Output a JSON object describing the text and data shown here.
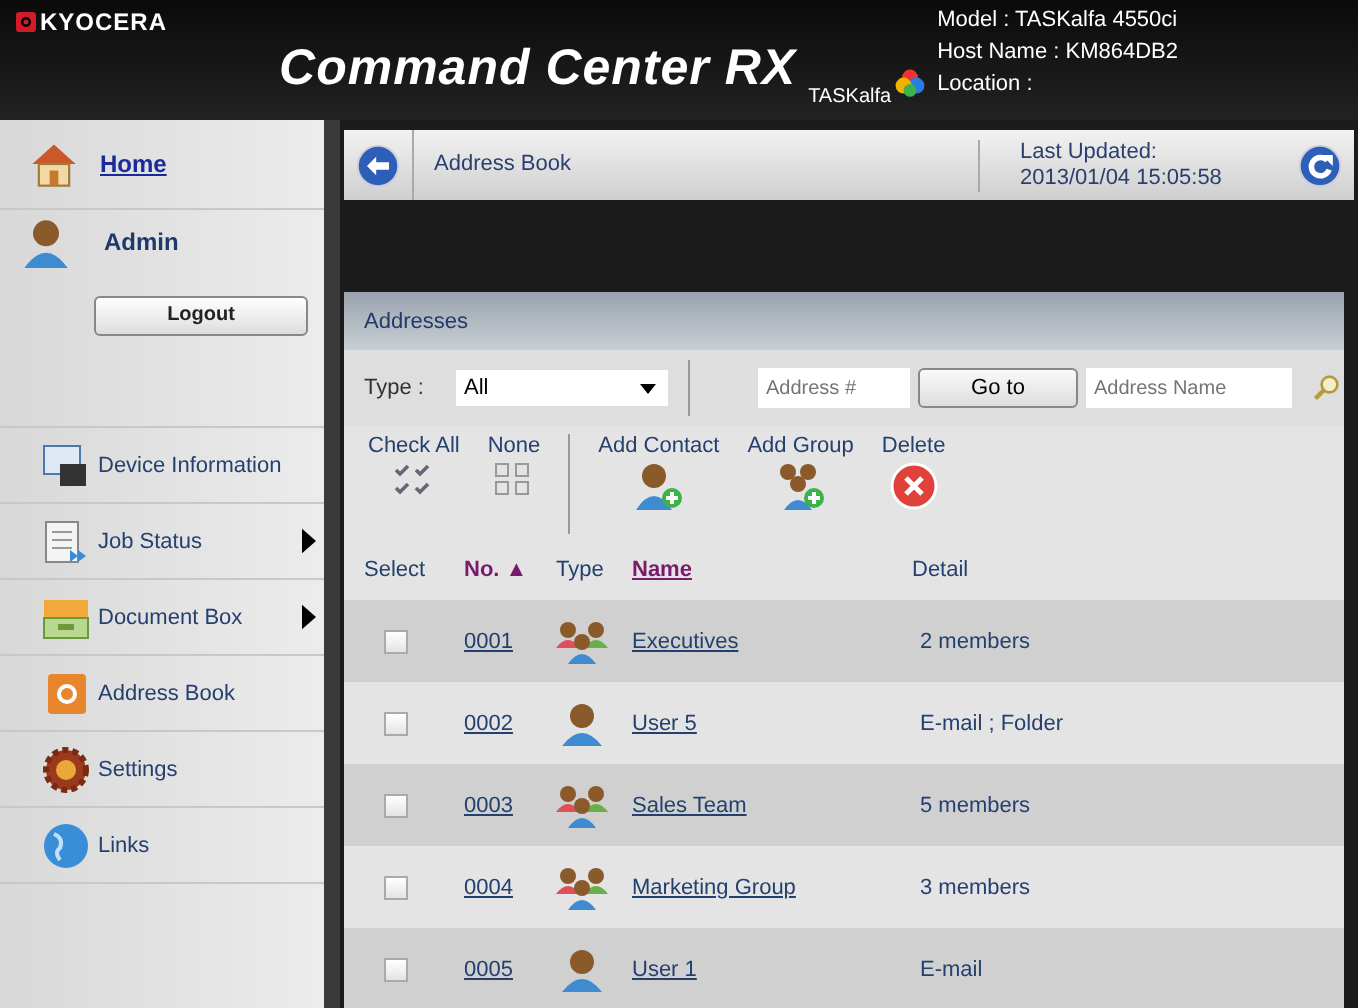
{
  "header": {
    "brand": "KYOCERA",
    "title": "Command Center RX",
    "product": "TASKalfa",
    "info": [
      "Model : TASKalfa 4550ci",
      "Host Name : KM864DB2",
      "Location :"
    ]
  },
  "sidebar": {
    "home": {
      "label": "Home"
    },
    "user": {
      "name": "Admin"
    },
    "logout": "Logout",
    "items": [
      {
        "label": "Device Information",
        "kind": "device",
        "has_submenu": false
      },
      {
        "label": "Job Status",
        "kind": "jobs",
        "has_submenu": true
      },
      {
        "label": "Document Box",
        "kind": "box",
        "has_submenu": true
      },
      {
        "label": "Address Book",
        "kind": "book",
        "has_submenu": false
      },
      {
        "label": "Settings",
        "kind": "gear",
        "has_submenu": false
      },
      {
        "label": "Links",
        "kind": "globe",
        "has_submenu": false
      }
    ]
  },
  "topbar": {
    "title": "Address Book",
    "updated_label": "Last Updated:",
    "updated_value": "2013/01/04 15:05:58"
  },
  "panel": {
    "title": "Addresses",
    "filter": {
      "type_label": "Type :",
      "type_value": "All",
      "number_placeholder": "Address #",
      "goto": "Go to",
      "name_placeholder": "Address Name"
    },
    "actions": [
      {
        "label": "Check All",
        "kind": "checkall"
      },
      {
        "label": "None",
        "kind": "none"
      },
      {
        "label": "Add Contact",
        "kind": "addcontact"
      },
      {
        "label": "Add Group",
        "kind": "addgroup"
      },
      {
        "label": "Delete",
        "kind": "delete"
      }
    ],
    "columns": [
      {
        "label": "Select",
        "kind": "plain"
      },
      {
        "label": "No.",
        "kind": "sorted",
        "sort_mark": "▲"
      },
      {
        "label": "Type",
        "kind": "plain"
      },
      {
        "label": "Name",
        "kind": "link"
      },
      {
        "label": "Detail",
        "kind": "plain"
      }
    ],
    "rows": [
      {
        "checked": false,
        "number": "0001",
        "kind": "group",
        "name": "Executives",
        "detail": "2 members"
      },
      {
        "checked": false,
        "number": "0002",
        "kind": "user",
        "name": "User 5",
        "detail": "E-mail ; Folder"
      },
      {
        "checked": false,
        "number": "0003",
        "kind": "group",
        "name": "Sales Team",
        "detail": "5 members"
      },
      {
        "checked": false,
        "number": "0004",
        "kind": "group",
        "name": "Marketing Group",
        "detail": "3 members"
      },
      {
        "checked": false,
        "number": "0005",
        "kind": "user",
        "name": "User 1",
        "detail": "E-mail"
      }
    ]
  }
}
